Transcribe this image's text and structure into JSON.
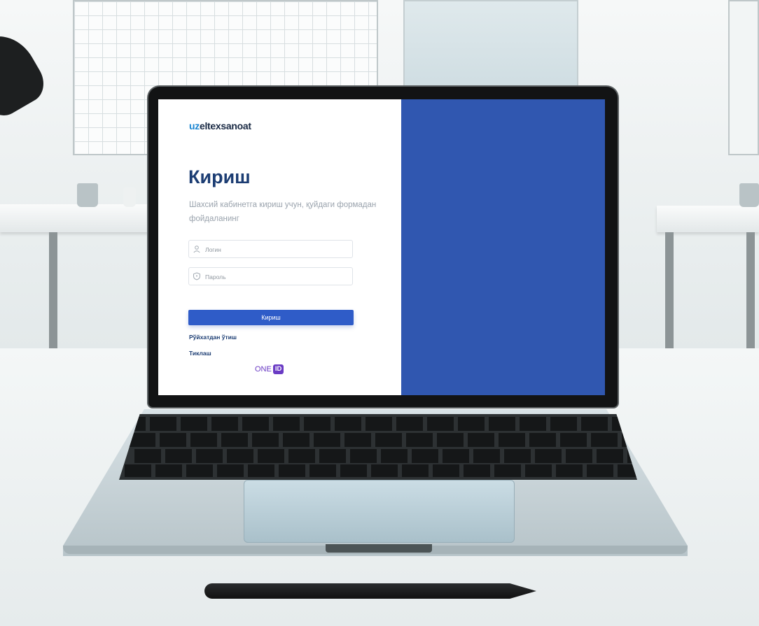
{
  "brand": {
    "logo_prefix": "uz",
    "logo_rest": "eltexsanoat",
    "accent_color": "#3057b0",
    "logo_prefix_color": "#1b86d2"
  },
  "login": {
    "title": "Кириш",
    "subtitle": "Шахсий кабинетга кириш учун, қуйдаги формадан фойдаланинг",
    "login_field": {
      "placeholder": "Логин",
      "icon": "user-icon"
    },
    "password_field": {
      "placeholder": "Пароль",
      "icon": "shield-icon"
    },
    "submit_label": "Кириш",
    "register_link": "Рўйхатдан ўтиш",
    "tiklash_link": "Тиклаш",
    "oneid": {
      "text": "ONE",
      "badge": "ID"
    }
  }
}
